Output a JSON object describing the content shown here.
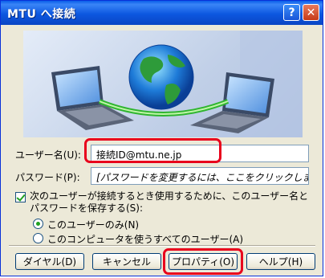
{
  "window": {
    "title": "MTU へ接続",
    "help_glyph": "?",
    "close_glyph": "✕"
  },
  "form": {
    "username_label": "ユーザー名(U):",
    "username_value": "接続ID@mtu.ne.jp",
    "password_label": "パスワード(P):",
    "password_value": "[パスワードを変更するには、ここをクリックします]",
    "save_checkbox_label": "次のユーザーが接続するとき使用するために、このユーザー名とパスワードを保存する(S):",
    "save_checkbox_checked": true,
    "radio_me_only": "このユーザーのみ(N)",
    "radio_anyone": "このコンピュータを使うすべてのユーザー(A)",
    "selected_radio": "radio_me_only"
  },
  "buttons": {
    "dial": "ダイヤル(D)",
    "cancel": "キャンセル",
    "properties": "プロパティ(O)",
    "help": "ヘルプ(H)"
  },
  "colors": {
    "highlight": "#e8001c",
    "title_bar": "#0a5de8"
  }
}
